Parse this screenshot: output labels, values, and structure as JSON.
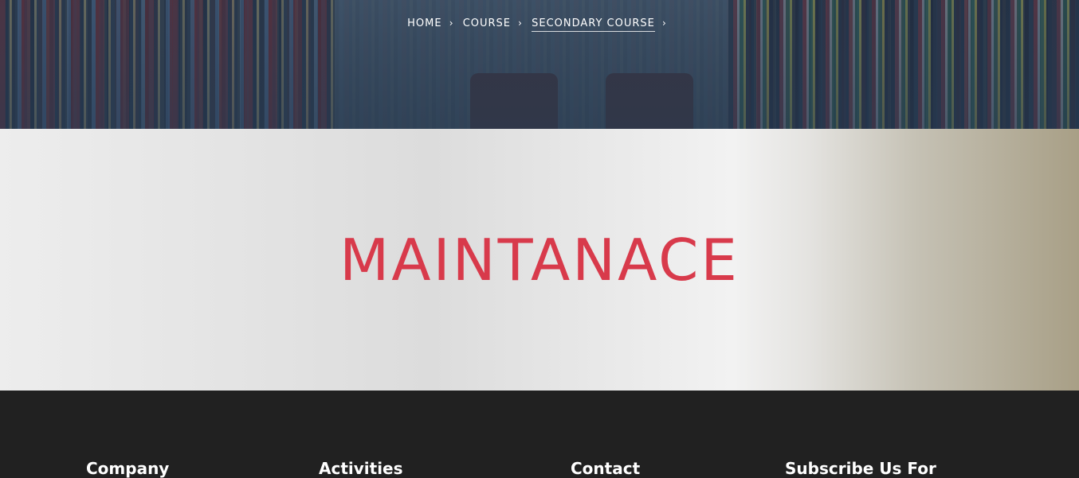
{
  "breadcrumb": {
    "items": [
      "HOME",
      "COURSE",
      "SECONDARY COURSE"
    ],
    "separator": "›"
  },
  "page": {
    "title": "MAINTANACE",
    "title_color": "#d83a4b"
  },
  "footer": {
    "columns": [
      "Company",
      "Activities",
      "Contact",
      "Subscribe Us For"
    ]
  }
}
